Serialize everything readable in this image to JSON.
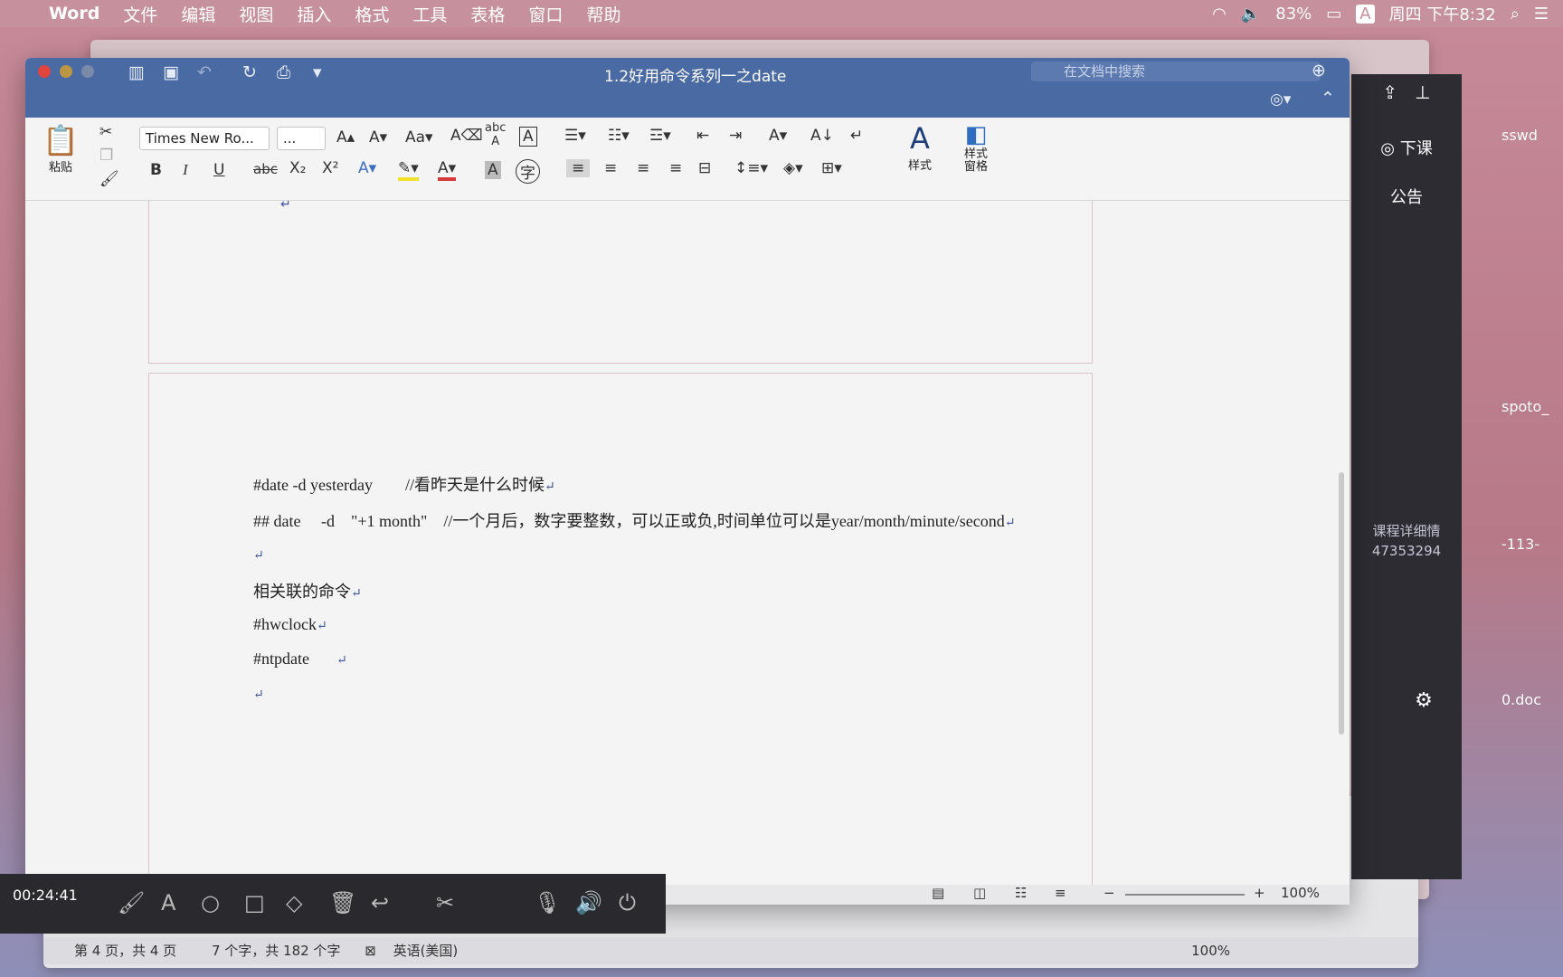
{
  "menubar": {
    "app": "Word",
    "menus": [
      "文件",
      "编辑",
      "视图",
      "插入",
      "格式",
      "工具",
      "表格",
      "窗口",
      "帮助"
    ],
    "battery": "83%",
    "clock": "周四 下午8:32",
    "input_method": "A"
  },
  "window": {
    "title": "1.2好用命令系列一之date",
    "search_placeholder": "在文档中搜索"
  },
  "ribbon": {
    "paste": "粘贴",
    "font_name": "Times New Ro...",
    "font_size": "...",
    "styles": "样式",
    "styles_pane": "样式\n窗格",
    "bold": "B",
    "italic": "I",
    "underline": "U",
    "strike": "abc",
    "sub": "X₂",
    "sup": "X²"
  },
  "document": {
    "lines": [
      {
        "text": "#date -d yesterday        //看昨天是什么时候"
      },
      {
        "text": "## date     -d    \"+1 month\"    //一个月后，数字要整数，可以正或负,时间单位可以是year/month/minute/second"
      },
      {
        "text": ""
      },
      {
        "text": "相关联的命令"
      },
      {
        "text": "#hwclock"
      },
      {
        "text": "#ntpdate"
      },
      {
        "text": ""
      }
    ],
    "para_mark": "↵"
  },
  "side_panel": {
    "class_end": "下课",
    "notice": "公告",
    "course_detail": "课程详细情",
    "course_id": "47353294",
    "bg_labels": [
      "sswd",
      "spoto_",
      "-113-",
      "0.doc"
    ]
  },
  "recorder": {
    "time": "00:24:41"
  },
  "statusbar": {
    "page": "第 4 页，共 4 页",
    "words": "7 个字，共 182 个字",
    "language": "英语(美国)",
    "zoom": "100%"
  }
}
